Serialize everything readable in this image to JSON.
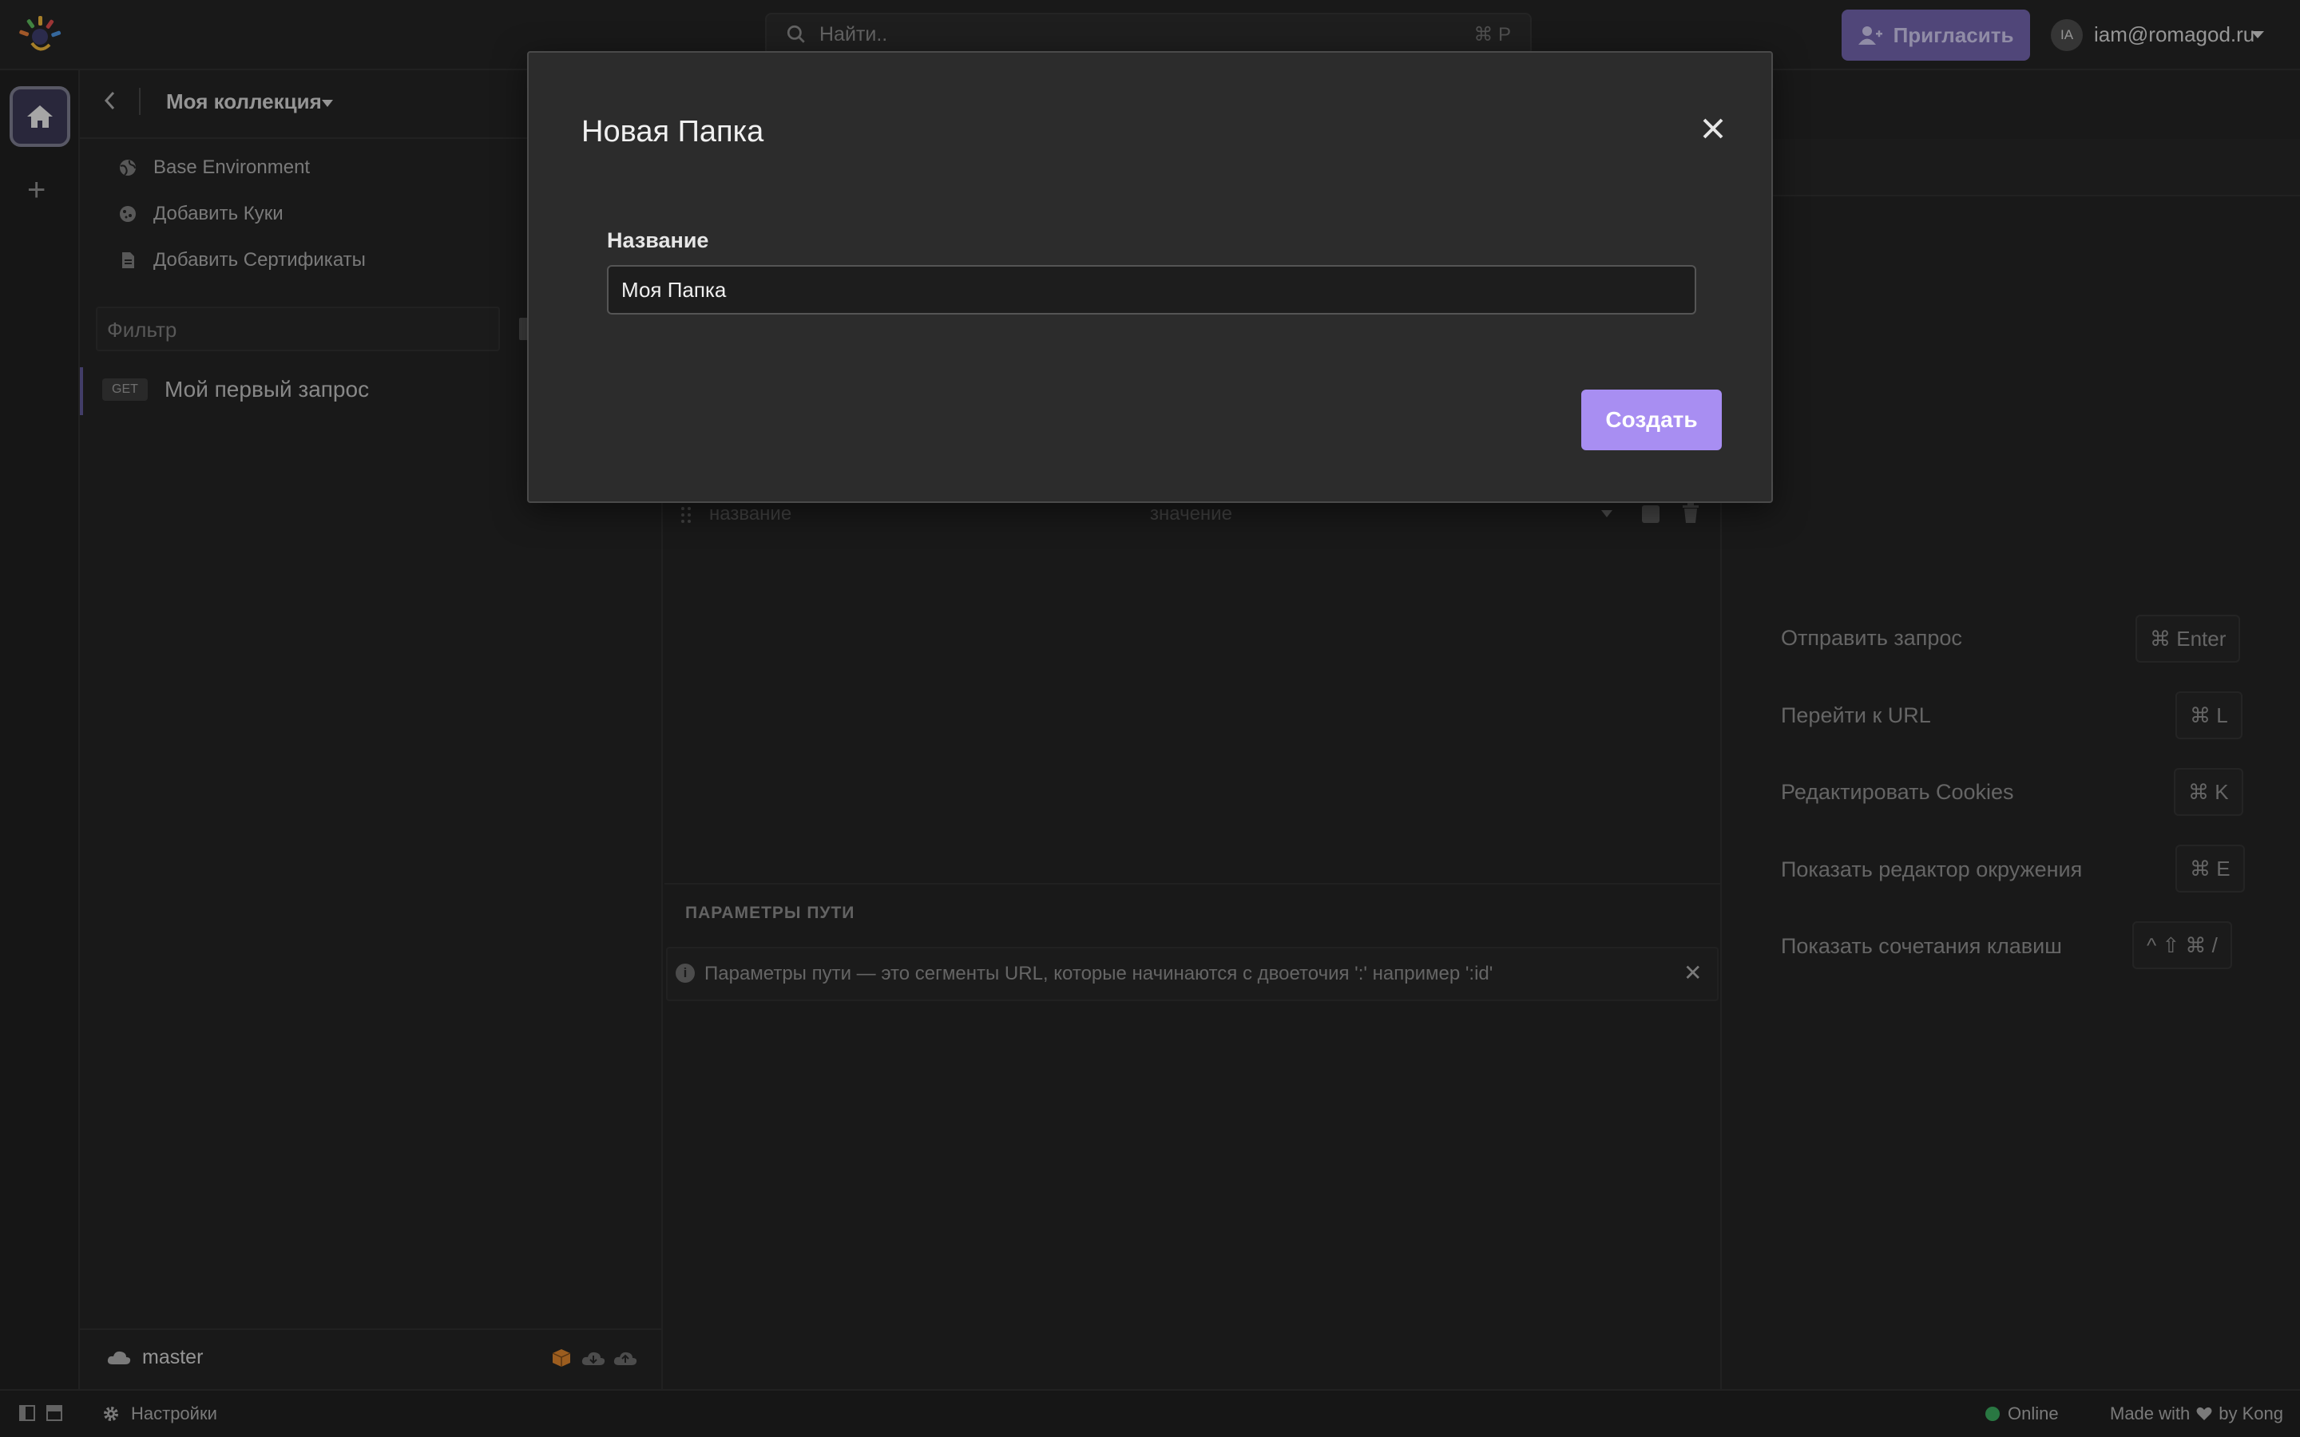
{
  "header": {
    "search_placeholder": "Найти..",
    "search_shortcut": "⌘ P",
    "invite_label": "Пригласить",
    "avatar_initials": "IA",
    "user_email": "iam@romagod.ru"
  },
  "sidebar": {
    "collection_name": "Моя коллекция",
    "items": [
      {
        "label": "Base Environment",
        "icon": "globe-icon"
      },
      {
        "label": "Добавить Куки",
        "icon": "cookie-icon"
      },
      {
        "label": "Добавить Сертификаты",
        "icon": "file-icon"
      }
    ],
    "filter_placeholder": "Фильтр",
    "request": {
      "method": "GET",
      "name": "Мой первый запрос"
    },
    "branch": "master"
  },
  "main": {
    "param_name_placeholder": "название",
    "param_value_placeholder": "значение",
    "path_params_title": "ПАРАМЕТРЫ ПУТИ",
    "path_params_notice": "Параметры пути — это сегменты URL, которые начинаются с двоеточия ':' например ':id'"
  },
  "shortcuts": [
    {
      "label": "Отправить запрос",
      "keys": "⌘ Enter"
    },
    {
      "label": "Перейти к URL",
      "keys": "⌘ L"
    },
    {
      "label": "Редактировать Cookies",
      "keys": "⌘ K"
    },
    {
      "label": "Показать редактор окружения",
      "keys": "⌘ E"
    },
    {
      "label": "Показать сочетания клавиш",
      "keys": "^ ⇧ ⌘ /"
    }
  ],
  "status": {
    "settings_label": "Настройки",
    "online_label": "Online",
    "made_with_prefix": "Made with",
    "made_with_suffix": "by Kong"
  },
  "modal": {
    "title": "Новая Папка",
    "field_label": "Название",
    "field_value": "Моя Папка",
    "create_label": "Создать"
  },
  "colors": {
    "accent": "#a88ef2",
    "invite": "#6f61a8",
    "online": "#3aa55c",
    "background": "#232323"
  }
}
